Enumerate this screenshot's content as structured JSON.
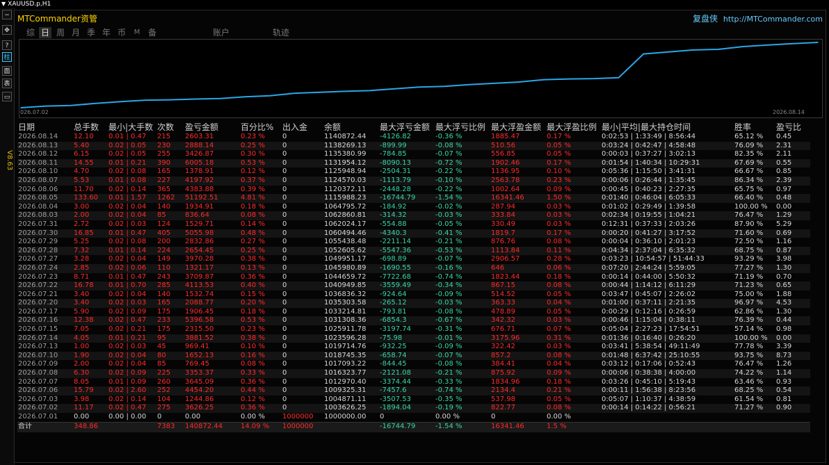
{
  "window": {
    "title": "XAUUSD.p,H1"
  },
  "toolbar": {
    "version": "V8.63",
    "buttons": [
      "−",
      "✥",
      "?",
      "柱",
      "面",
      "表",
      "▭"
    ]
  },
  "app": {
    "brand": "MTCommander资管",
    "replay_label": "复盘侠",
    "url": "http://MTCommander.com"
  },
  "tabs": [
    "综",
    "日",
    "周",
    "月",
    "季",
    "年",
    "币",
    "M",
    "备",
    "账户",
    "轨迹"
  ],
  "chart": {
    "start_label": "026.07.02",
    "end_label": "2026.08.14",
    "line_color": "#29a8e8"
  },
  "chart_data": {
    "type": "line",
    "title": "",
    "x": [
      "2026.07.01",
      "2026.07.02",
      "2026.07.03",
      "2026.07.06",
      "2026.07.07",
      "2026.07.08",
      "2026.07.09",
      "2026.07.10",
      "2026.07.13",
      "2026.07.14",
      "2026.07.15",
      "2026.07.16",
      "2026.07.17",
      "2026.07.20",
      "2026.07.21",
      "2026.07.22",
      "2026.07.23",
      "2026.07.24",
      "2026.07.27",
      "2026.07.28",
      "2026.07.29",
      "2026.07.30",
      "2026.07.31",
      "2026.08.03",
      "2026.08.04",
      "2026.08.05",
      "2026.08.06",
      "2026.08.07",
      "2026.08.10",
      "2026.08.11",
      "2026.08.12",
      "2026.08.13",
      "2026.08.14"
    ],
    "series": [
      {
        "values": [
          1000000.0,
          1003626.25,
          1004871.11,
          1009325.31,
          1012970.4,
          1016323.77,
          1017093.22,
          1018745.35,
          1019714.76,
          1023596.28,
          1025911.78,
          1031308.36,
          1033214.81,
          1035303.58,
          1036836.32,
          1040949.85,
          1044659.72,
          1045980.89,
          1049951.17,
          1052605.62,
          1055438.48,
          1060494.46,
          1062024.17,
          1062860.81,
          1064795.72,
          1115988.23,
          1120372.11,
          1124570.03,
          1125948.94,
          1131954.12,
          1135380.99,
          1138269.13,
          1140872.44
        ]
      }
    ]
  },
  "table": {
    "headers": [
      "日期",
      "总手数",
      "最小|大手数",
      "次数",
      "盈亏金额",
      "百分比%",
      "出入金",
      "余额",
      "最大浮亏金额",
      "最大浮亏比例",
      "最大浮盈金额",
      "最大浮盈比例",
      "最小|平均|最大持仓时间",
      "胜率",
      "盈亏比"
    ],
    "rows": [
      [
        "2026.08.14",
        "12.10",
        "0.01 | 0.47",
        "215",
        "2603.31",
        "0.23 %",
        "0",
        "1140872.44",
        "-4126.82",
        "-0.36 %",
        "1885.47",
        "0.17 %",
        "0:02:53 | 1:33:49 | 8:56:44",
        "65.12 %",
        "0.45"
      ],
      [
        "2026.08.13",
        "5.40",
        "0.02 | 0.05",
        "230",
        "2888.14",
        "0.25 %",
        "0",
        "1138269.13",
        "-899.99",
        "-0.08 %",
        "510.56",
        "0.05 %",
        "0:03:24 | 0:42:47 | 4:58:48",
        "76.09 %",
        "2.31"
      ],
      [
        "2026.08.12",
        "6.15",
        "0.02 | 0.05",
        "255",
        "3426.87",
        "0.30 %",
        "0",
        "1135380.99",
        "-784.85",
        "-0.07 %",
        "556.85",
        "0.05 %",
        "0:00:03 | 0:37:27 | 3:02:13",
        "82.35 %",
        "2.11"
      ],
      [
        "2026.08.11",
        "14.55",
        "0.01 | 0.21",
        "390",
        "6005.18",
        "0.53 %",
        "0",
        "1131954.12",
        "-8090.13",
        "-0.72 %",
        "1902.46",
        "0.17 %",
        "0:01:54 | 1:40:34 | 10:29:31",
        "67.69 %",
        "0.55"
      ],
      [
        "2026.08.10",
        "4.70",
        "0.02 | 0.08",
        "165",
        "1378.91",
        "0.12 %",
        "0",
        "1125948.94",
        "-2504.31",
        "-0.22 %",
        "1136.95",
        "0.10 %",
        "0:05:36 | 1:15:50 | 3:41:31",
        "66.67 %",
        "0.85"
      ],
      [
        "2026.08.07",
        "5.53",
        "0.01 | 0.08",
        "227",
        "4197.92",
        "0.37 %",
        "0",
        "1124570.03",
        "-1113.79",
        "-0.10 %",
        "2563.78",
        "0.23 %",
        "0:00:06 | 0:26:44 | 1:35:45",
        "86.34 %",
        "2.39"
      ],
      [
        "2026.08.06",
        "11.70",
        "0.02 | 0.14",
        "365",
        "4383.88",
        "0.39 %",
        "0",
        "1120372.11",
        "-2448.28",
        "-0.22 %",
        "1002.64",
        "0.09 %",
        "0:00:45 | 0:40:23 | 2:27:35",
        "65.75 %",
        "0.97"
      ],
      [
        "2026.08.05",
        "133.60",
        "0.01 | 1.57",
        "1262",
        "51192.51",
        "4.81 %",
        "0",
        "1115988.23",
        "-16744.79",
        "-1.54 %",
        "16341.46",
        "1.50 %",
        "0:01:40 | 0:46:04 | 6:05:33",
        "66.40 %",
        "0.48"
      ],
      [
        "2026.08.04",
        "3.00",
        "0.02 | 0.04",
        "140",
        "1934.91",
        "0.18 %",
        "0",
        "1064795.72",
        "-184.92",
        "-0.02 %",
        "287.94",
        "0.03 %",
        "0:01:02 | 0:29:49 | 1:39:58",
        "100.00 %",
        "0.00"
      ],
      [
        "2026.08.03",
        "2.00",
        "0.02 | 0.04",
        "85",
        "836.64",
        "0.08 %",
        "0",
        "1062860.81",
        "-314.32",
        "-0.03 %",
        "333.84",
        "0.03 %",
        "0:02:34 | 0:19:55 | 1:04:21",
        "76.47 %",
        "1.29"
      ],
      [
        "2026.07.31",
        "2.72",
        "0.02 | 0.03",
        "124",
        "1529.71",
        "0.14 %",
        "0",
        "1062024.17",
        "-554.88",
        "-0.05 %",
        "330.49",
        "0.03 %",
        "0:12:31 | 0:37:33 | 2:03:26",
        "87.90 %",
        "5.29"
      ],
      [
        "2026.07.30",
        "16.85",
        "0.01 | 0.47",
        "405",
        "5055.98",
        "0.48 %",
        "0",
        "1060494.46",
        "-4340.3",
        "-0.41 %",
        "1819.7",
        "0.17 %",
        "0:00:20 | 0:41:27 | 3:17:52",
        "71.60 %",
        "0.69"
      ],
      [
        "2026.07.29",
        "5.25",
        "0.02 | 0.08",
        "200",
        "2832.86",
        "0.27 %",
        "0",
        "1055438.48",
        "-2211.14",
        "-0.21 %",
        "876.76",
        "0.08 %",
        "0:00:04 | 0:36:10 | 2:01:23",
        "72.50 %",
        "1.16"
      ],
      [
        "2026.07.28",
        "7.32",
        "0.01 | 0.14",
        "224",
        "2654.45",
        "0.25 %",
        "0",
        "1052605.62",
        "-5547.36",
        "-0.53 %",
        "1113.84",
        "0.11 %",
        "0:04:34 | 2:37:04 | 6:35:32",
        "68.75 %",
        "0.87"
      ],
      [
        "2026.07.27",
        "3.28",
        "0.02 | 0.04",
        "149",
        "3970.28",
        "0.38 %",
        "0",
        "1049951.17",
        "-698.89",
        "-0.07 %",
        "2906.57",
        "0.28 %",
        "0:03:23 | 10:54:57 | 51:44:33",
        "93.29 %",
        "3.98"
      ],
      [
        "2026.07.24",
        "2.85",
        "0.02 | 0.06",
        "110",
        "1321.17",
        "0.13 %",
        "0",
        "1045980.89",
        "-1690.55",
        "-0.16 %",
        "646",
        "0.06 %",
        "0:07:20 | 2:44:24 | 5:59:05",
        "77.27 %",
        "1.30"
      ],
      [
        "2026.07.23",
        "8.71",
        "0.01 | 0.47",
        "243",
        "3709.87",
        "0.36 %",
        "0",
        "1044659.72",
        "-7722.68",
        "-0.74 %",
        "1823.44",
        "0.18 %",
        "0:00:14 | 0:44:00 | 5:50:32",
        "71.19 %",
        "0.70"
      ],
      [
        "2026.07.22",
        "16.78",
        "0.01 | 0.70",
        "285",
        "4113.53",
        "0.40 %",
        "0",
        "1040949.85",
        "-3559.49",
        "-0.34 %",
        "867.15",
        "0.08 %",
        "0:00:44 | 1:14:12 | 6:11:29",
        "71.23 %",
        "0.65"
      ],
      [
        "2026.07.21",
        "3.40",
        "0.02 | 0.04",
        "140",
        "1532.74",
        "0.15 %",
        "0",
        "1036836.32",
        "-924.64",
        "-0.09 %",
        "514.52",
        "0.05 %",
        "0:03:47 | 0:45:07 | 2:26:02",
        "75.00 %",
        "1.88"
      ],
      [
        "2026.07.20",
        "3.40",
        "0.02 | 0.03",
        "165",
        "2088.77",
        "0.20 %",
        "0",
        "1035303.58",
        "-265.12",
        "-0.03 %",
        "363.33",
        "0.04 %",
        "0:01:00 | 0:37:11 | 2:21:35",
        "96.97 %",
        "4.53"
      ],
      [
        "2026.07.17",
        "5.90",
        "0.02 | 0.09",
        "175",
        "1906.45",
        "0.18 %",
        "0",
        "1033214.81",
        "-793.81",
        "-0.08 %",
        "478.89",
        "0.05 %",
        "0:00:29 | 0:12:16 | 0:26:59",
        "62.86 %",
        "1.30"
      ],
      [
        "2026.07.16",
        "12.38",
        "0.02 | 0.47",
        "233",
        "5396.58",
        "0.53 %",
        "0",
        "1031308.36",
        "-6854.3",
        "-0.67 %",
        "342.32",
        "0.03 %",
        "0:00:46 | 1:15:04 | 0:38:11",
        "76.39 %",
        "0.44"
      ],
      [
        "2026.07.15",
        "7.05",
        "0.02 | 0.21",
        "175",
        "2315.50",
        "0.23 %",
        "0",
        "1025911.78",
        "-3197.74",
        "-0.31 %",
        "676.71",
        "0.07 %",
        "0:05:04 | 2:27:23 | 17:54:51",
        "57.14 %",
        "0.98"
      ],
      [
        "2026.07.14",
        "4.05",
        "0.01 | 0.21",
        "95",
        "3881.52",
        "0.38 %",
        "0",
        "1023596.28",
        "-75.98",
        "-0.01 %",
        "3175.96",
        "0.31 %",
        "0:01:36 | 0:16:40 | 0:26:20",
        "100.00 %",
        "0.00"
      ],
      [
        "2026.07.13",
        "1.00",
        "0.02 | 0.03",
        "45",
        "969.41",
        "0.10 %",
        "0",
        "1019714.76",
        "-932.25",
        "-0.09 %",
        "322.42",
        "0.03 %",
        "0:03:41 | 5:38:54 | 49:11:49",
        "77.78 %",
        "3.39"
      ],
      [
        "2026.07.10",
        "1.90",
        "0.02 | 0.04",
        "80",
        "1652.13",
        "0.16 %",
        "0",
        "1018745.35",
        "-658.74",
        "-0.07 %",
        "857.2",
        "0.08 %",
        "0:01:48 | 6:37:42 | 25:10:55",
        "93.75 %",
        "8.73"
      ],
      [
        "2026.07.09",
        "2.00",
        "0.02 | 0.04",
        "85",
        "769.45",
        "0.08 %",
        "0",
        "1017093.22",
        "-844.45",
        "-0.08 %",
        "384.41",
        "0.04 %",
        "0:03:12 | 0:17:06 | 0:52:43",
        "76.47 %",
        "1.26"
      ],
      [
        "2026.07.08",
        "6.30",
        "0.02 | 0.09",
        "225",
        "3353.37",
        "0.33 %",
        "0",
        "1016323.77",
        "-2121.08",
        "-0.21 %",
        "875.92",
        "0.09 %",
        "0:00:06 | 0:38:38 | 4:00:00",
        "74.22 %",
        "1.14"
      ],
      [
        "2026.07.07",
        "8.05",
        "0.01 | 0.09",
        "260",
        "3645.09",
        "0.36 %",
        "0",
        "1012970.40",
        "-3374.44",
        "-0.33 %",
        "1834.96",
        "0.18 %",
        "0:03:26 | 0:45:10 | 5:19:43",
        "63.46 %",
        "0.93"
      ],
      [
        "2026.07.06",
        "15.79",
        "0.02 | 2.60",
        "252",
        "4454.20",
        "0.44 %",
        "0",
        "1009325.31",
        "-7457.6",
        "-0.74 %",
        "2134.4",
        "0.21 %",
        "0:00:11 | 1:56:38 | 8:23:56",
        "68.25 %",
        "0.54"
      ],
      [
        "2026.07.03",
        "3.98",
        "0.02 | 0.14",
        "104",
        "1244.86",
        "0.12 %",
        "0",
        "1004871.11",
        "-3507.53",
        "-0.35 %",
        "537.98",
        "0.05 %",
        "0:05:07 | 1:10:37 | 4:38:59",
        "61.54 %",
        "0.81"
      ],
      [
        "2026.07.02",
        "11.17",
        "0.02 | 0.47",
        "275",
        "3626.25",
        "0.36 %",
        "0",
        "1003626.25",
        "-1894.04",
        "-0.19 %",
        "822.77",
        "0.08 %",
        "0:00:14 | 0:14:22 | 0:56:21",
        "71.27 %",
        "0.90"
      ],
      [
        "2026.07.01",
        "0.00",
        "0.00 | 0.00",
        "0",
        "0.00",
        "0.00 %",
        "1000000",
        "1000000.00",
        "0",
        "0.00 %",
        "0",
        "0.00 %",
        "",
        "",
        ""
      ]
    ],
    "total": [
      "合计",
      "348.86",
      "",
      "7383",
      "140872.44",
      "14.09 %",
      "1000000",
      "",
      "-16744.79",
      "-1.54 %",
      "16341.46",
      "1.5 %",
      "",
      "",
      ""
    ]
  }
}
